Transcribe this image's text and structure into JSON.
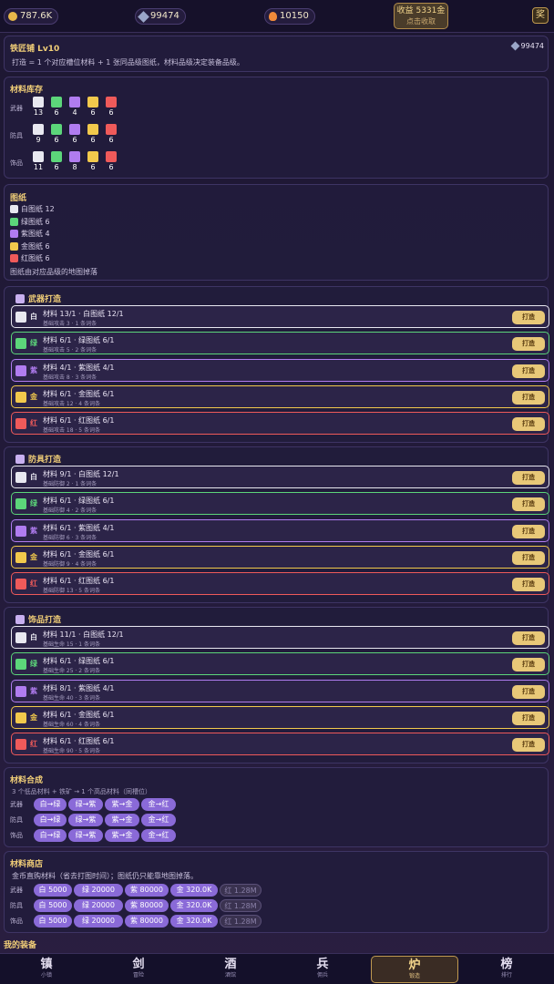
{
  "topbar": {
    "gold": "787.6K",
    "gems": "99474",
    "embers": "10150",
    "income_title": "收益 5331金",
    "income_sub": "点击收取",
    "reward": "奖"
  },
  "header": {
    "title": "铁匠铺 Lv10",
    "gem_count": "99474",
    "desc": "打造 = 1 个对应槽位材料 + 1 张同品级图纸，材料品级决定装备品级。"
  },
  "inventory": {
    "title": "材料库存",
    "rows": [
      {
        "label": "武器",
        "counts": [
          "13",
          "6",
          "4",
          "6",
          "6"
        ]
      },
      {
        "label": "防具",
        "counts": [
          "9",
          "6",
          "6",
          "6",
          "6"
        ]
      },
      {
        "label": "饰品",
        "counts": [
          "11",
          "6",
          "8",
          "6",
          "6"
        ]
      }
    ]
  },
  "blueprints": {
    "title": "图纸",
    "items": [
      "白图纸 12",
      "绿图纸 6",
      "紫图纸 4",
      "金图纸 6",
      "红图纸 6"
    ],
    "note": "图纸由对应品级的地图掉落"
  },
  "colors": {
    "white": "#e8e8f0",
    "green": "#5cd67a",
    "purple": "#b07cf0",
    "gold": "#f2c94c",
    "red": "#ef5a5a"
  },
  "sections": [
    {
      "title": "武器打造",
      "rows": [
        {
          "q": "白",
          "l1": "材料 13/1 · 白图纸 12/1",
          "l2": "基础攻击 3 · 1 条词条",
          "btn": "打造"
        },
        {
          "q": "绿",
          "l1": "材料 6/1 · 绿图纸 6/1",
          "l2": "基础攻击 5 · 2 条词条",
          "btn": "打造"
        },
        {
          "q": "紫",
          "l1": "材料 4/1 · 紫图纸 4/1",
          "l2": "基础攻击 8 · 3 条词条",
          "btn": "打造"
        },
        {
          "q": "金",
          "l1": "材料 6/1 · 金图纸 6/1",
          "l2": "基础攻击 12 · 4 条词条",
          "btn": "打造"
        },
        {
          "q": "红",
          "l1": "材料 6/1 · 红图纸 6/1",
          "l2": "基础攻击 18 · 5 条词条",
          "btn": "打造"
        }
      ]
    },
    {
      "title": "防具打造",
      "rows": [
        {
          "q": "白",
          "l1": "材料 9/1 · 白图纸 12/1",
          "l2": "基础防御 2 · 1 条词条",
          "btn": "打造"
        },
        {
          "q": "绿",
          "l1": "材料 6/1 · 绿图纸 6/1",
          "l2": "基础防御 4 · 2 条词条",
          "btn": "打造"
        },
        {
          "q": "紫",
          "l1": "材料 6/1 · 紫图纸 4/1",
          "l2": "基础防御 6 · 3 条词条",
          "btn": "打造"
        },
        {
          "q": "金",
          "l1": "材料 6/1 · 金图纸 6/1",
          "l2": "基础防御 9 · 4 条词条",
          "btn": "打造"
        },
        {
          "q": "红",
          "l1": "材料 6/1 · 红图纸 6/1",
          "l2": "基础防御 13 · 5 条词条",
          "btn": "打造"
        }
      ]
    },
    {
      "title": "饰品打造",
      "rows": [
        {
          "q": "白",
          "l1": "材料 11/1 · 白图纸 12/1",
          "l2": "基础生命 15 · 1 条词条",
          "btn": "打造"
        },
        {
          "q": "绿",
          "l1": "材料 6/1 · 绿图纸 6/1",
          "l2": "基础生命 25 · 2 条词条",
          "btn": "打造"
        },
        {
          "q": "紫",
          "l1": "材料 8/1 · 紫图纸 4/1",
          "l2": "基础生命 40 · 3 条词条",
          "btn": "打造"
        },
        {
          "q": "金",
          "l1": "材料 6/1 · 金图纸 6/1",
          "l2": "基础生命 60 · 4 条词条",
          "btn": "打造"
        },
        {
          "q": "红",
          "l1": "材料 6/1 · 红图纸 6/1",
          "l2": "基础生命 90 · 5 条词条",
          "btn": "打造"
        }
      ]
    }
  ],
  "synth": {
    "title": "材料合成",
    "desc": "3 个低品材料 + 铁矿 → 1 个高品材料（同槽位）",
    "rows": [
      {
        "label": "武器",
        "btns": [
          "白→绿",
          "绿→紫",
          "紫→金",
          "金→红"
        ]
      },
      {
        "label": "防具",
        "btns": [
          "白→绿",
          "绿→紫",
          "紫→金",
          "金→红"
        ]
      },
      {
        "label": "饰品",
        "btns": [
          "白→绿",
          "绿→紫",
          "紫→金",
          "金→红"
        ]
      }
    ]
  },
  "shop": {
    "title": "材料商店",
    "desc": "金币直购材料（省去打图时间）；图纸仍只能靠地图掉落。",
    "rows": [
      {
        "label": "武器",
        "btns": [
          "白 5000",
          "绿 20000",
          "紫 80000",
          "金 320.0K",
          "红 1.28M"
        ]
      },
      {
        "label": "防具",
        "btns": [
          "白 5000",
          "绿 20000",
          "紫 80000",
          "金 320.0K",
          "红 1.28M"
        ]
      },
      {
        "label": "饰品",
        "btns": [
          "白 5000",
          "绿 20000",
          "紫 80000",
          "金 320.0K",
          "红 1.28M"
        ]
      }
    ]
  },
  "equip_title": "我的装备",
  "nav": [
    {
      "g": "镇",
      "s": "小镇"
    },
    {
      "g": "剑",
      "s": "冒险"
    },
    {
      "g": "酒",
      "s": "酒馆"
    },
    {
      "g": "兵",
      "s": "佣兵"
    },
    {
      "g": "炉",
      "s": "锻造"
    },
    {
      "g": "榜",
      "s": "排行"
    }
  ]
}
